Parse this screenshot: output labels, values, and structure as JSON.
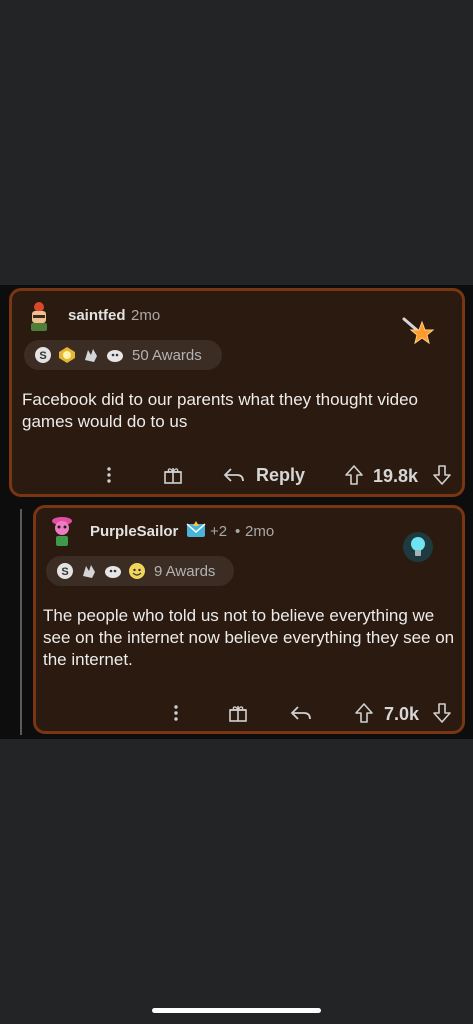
{
  "comment1": {
    "username": "saintfed",
    "time": "2mo",
    "awards_count": "50 Awards",
    "body": "Facebook did to our parents what they thought video games would do to us",
    "reply_label": "Reply",
    "score": "19.8k",
    "award_icons": [
      "silver-award-icon",
      "gold-award-icon",
      "hand-award-icon",
      "ghost-award-icon"
    ],
    "flair_icon": "shooting-star-icon"
  },
  "comment2": {
    "username": "PurpleSailor",
    "flair_extra": "+2",
    "time": "2mo",
    "awards_count": "9 Awards",
    "body": "The people who told us not to believe everything we see on the internet now believe everything they see on the internet.",
    "score": "7.0k",
    "award_icons": [
      "silver-award-icon",
      "hand-award-icon",
      "ghost-award-icon",
      "smiley-award-icon"
    ],
    "flair_icon": "lightbulb-icon"
  },
  "colors": {
    "card_bg": "#2a1a10",
    "card_border": "#7a3512",
    "page_bg": "#232426"
  }
}
